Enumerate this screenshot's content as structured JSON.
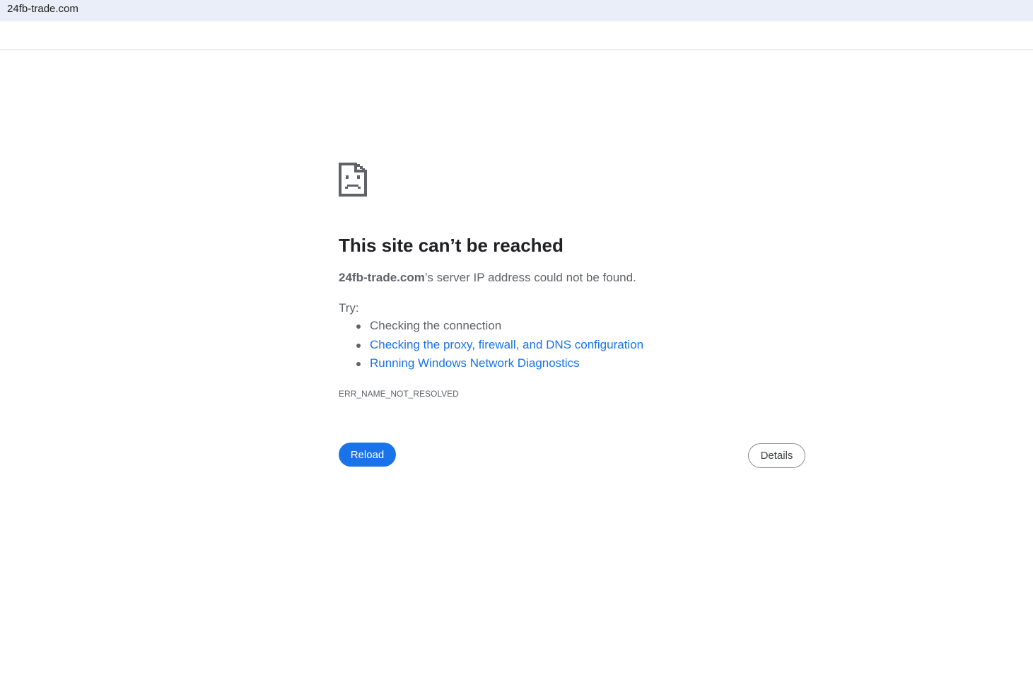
{
  "browser": {
    "url": "24fb-trade.com"
  },
  "error": {
    "icon": "sad-document-icon",
    "title": "This site can’t be reached",
    "host": "24fb-trade.com",
    "summary_rest": "’s server IP address could not be found.",
    "try_label": "Try:",
    "suggestions": [
      {
        "text": "Checking the connection",
        "link": false
      },
      {
        "text": "Checking the proxy, firewall, and DNS configuration",
        "link": true
      },
      {
        "text": "Running Windows Network Diagnostics",
        "link": true
      }
    ],
    "code": "ERR_NAME_NOT_RESOLVED"
  },
  "buttons": {
    "reload": "Reload",
    "details": "Details"
  },
  "colors": {
    "accent": "#1a73e8",
    "text_secondary": "#5f6368",
    "heading": "#202124",
    "url_bar": "#e9eef8"
  }
}
